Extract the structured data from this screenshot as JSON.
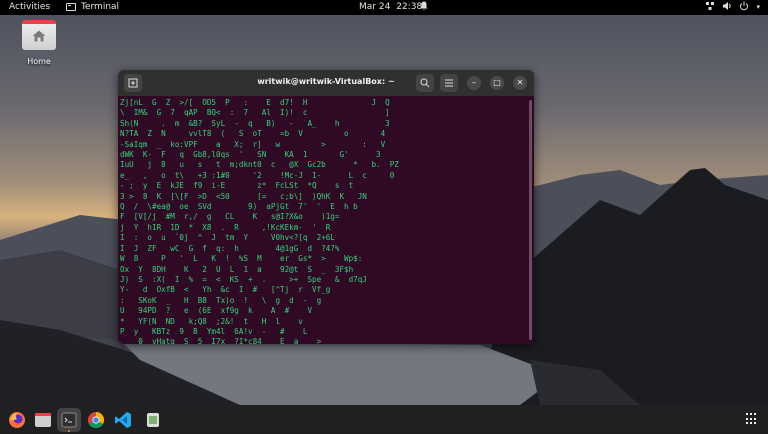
{
  "topbar": {
    "activities": "Activities",
    "app_name": "Terminal",
    "date": "Mar 24",
    "time": "22:38"
  },
  "desktop": {
    "home_label": "Home"
  },
  "terminal": {
    "title": "writwik@writwik-VirtualBox: ~",
    "lines": [
      "Zj[nL  G  Z  >/[  OD5  P   :    E  d7!  H              J  Q",
      "\\  IM&  G  7  qAP  BQ<  :  7   Al  I)!  c                 ]",
      "Sh(N     .  m  &B?  SyL  -  q   B)   -   A_    h          3",
      "N?TA  Z  N     vvlT8  (   S  oT    =b  V         o       4",
      "-SaIqm  _  ko:VPF    a   X;  r]   w         >        :   V",
      "dWK  K-  F   q  Gb8,l0qs  '   SN    KA  1       G'      3",
      "IuU   j  8   u   s   t  m;dknt0  c   @X  Gc2b      *   b.  PZ",
      "e_   ,   o  t\\   +3 :1#0     '2    !Mc-J  1-      L  c     0",
      "- ;  y  E  kJE  f9  i-E       z*  FcLSt  *Q    s  t",
      "3 >  8  K  [\\[F  >D  <50      [=   c;b\\]  )QhK  K   JN",
      "Q  /  \\#ea@  oe  SVd        9)  aPjGt  7'  '  E  h b",
      "F  [V[/j  #M  r,/  g   CL    K   s@I?X&o    )1g=",
      "j  Y  h1R  1D  *  X8  .  R     ,!KcKEkm-  '  R",
      "I  :  o  u  `0j  ^  J  tm  Y     V0hv<?[q  2+6L",
      "I  J  ZF   wC  G  f  q:  h        4@1gG  d  ?4?%",
      "W  8     P   '  L   K  !  %S  M    er  Gs*  >    Wp$:",
      "Ox  Y  8DH    K   2  U  L  1  a    92@t  S  _  3F$h",
      "J)  S  :X(  I  %  =  <  KS  +  .     >+  Spe   &  d7qJ",
      "Y-   d  OxfB  <   Yh  &c  I  #   [^Tj  r  Vf_g",
      ":   SKoK  _   H  B8  Tx)o  !   \\  g  d  -  g",
      "U   94PD  ?   e  (6E  xf9g  k    A  #    V",
      "*   YF(N  ND   k;Q8  ;2&!  t   H  l    v",
      "P  y   KBTz  9  B  Ym4l  6A!v  -   #    L",
      "_   0  vHatg  S  5  I7x  ?I*c84    E  a    >"
    ]
  },
  "dock": {
    "items": [
      "firefox-icon",
      "files-icon",
      "terminal-icon",
      "chrome-icon",
      "vscode-icon",
      "trash-icon"
    ]
  }
}
